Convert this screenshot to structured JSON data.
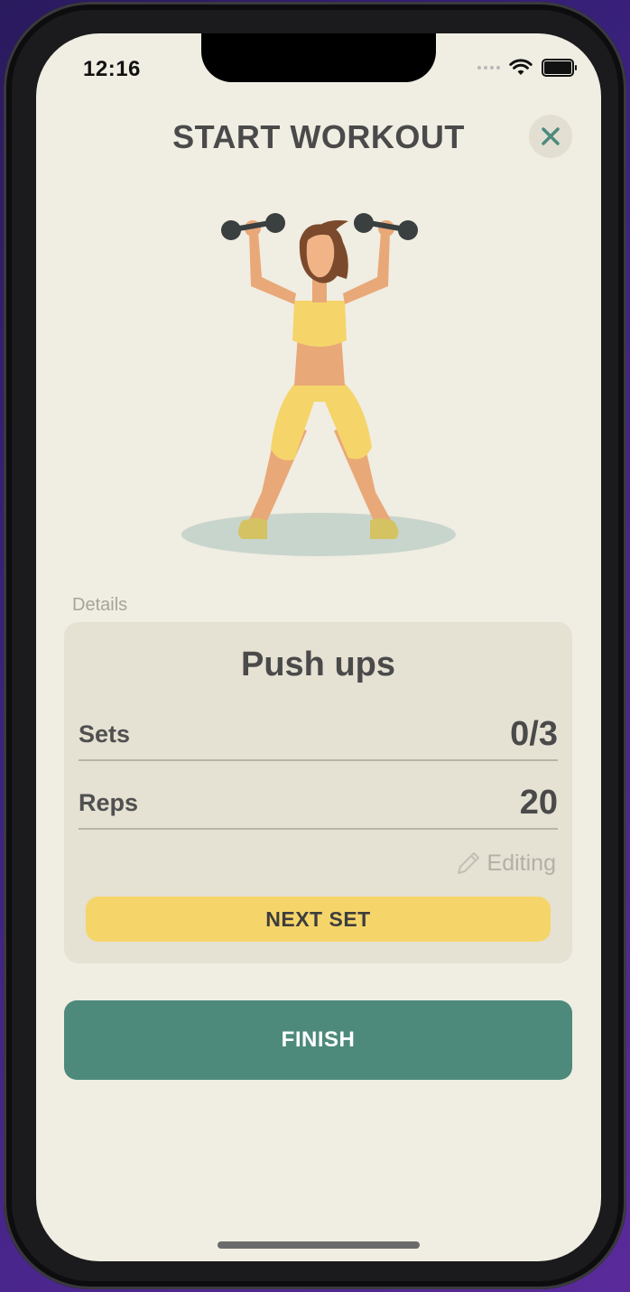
{
  "status_bar": {
    "time": "12:16"
  },
  "header": {
    "title": "START WORKOUT",
    "close_icon": "close-icon"
  },
  "details": {
    "section_label": "Details",
    "exercise_name": "Push ups",
    "sets_label": "Sets",
    "sets_value": "0/3",
    "reps_label": "Reps",
    "reps_value": "20",
    "editing_label": "Editing",
    "next_set_label": "NEXT SET"
  },
  "actions": {
    "finish_label": "FINISH"
  },
  "colors": {
    "background": "#f0ede2",
    "card": "#e5e1d3",
    "accent_green": "#4d8a7c",
    "accent_yellow": "#f5d56a",
    "text_dark": "#4a4a4a"
  }
}
